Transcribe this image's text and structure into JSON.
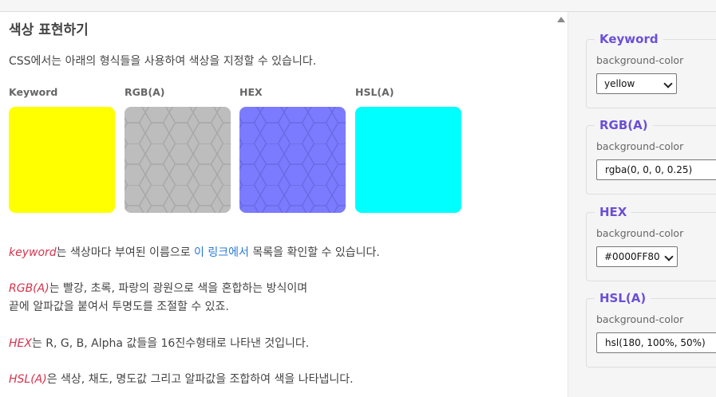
{
  "main": {
    "title": "색상 표현하기",
    "intro": "CSS에서는 아래의 형식들을 사용하여 색상을 지정할 수 있습니다.",
    "swatches": [
      {
        "label": "Keyword",
        "color": "#ffff00"
      },
      {
        "label": "RGB(A)",
        "color": "#bdbdbd"
      },
      {
        "label": "HEX",
        "color": "#7b7bff"
      },
      {
        "label": "HSL(A)",
        "color": "#00ffff"
      }
    ],
    "para_keyword": {
      "term": "keyword",
      "text1": "는 색상마다 부여된 이름으로 ",
      "link": "이 링크에서",
      "text2": " 목록을 확인할 수 있습니다."
    },
    "para_rgb": {
      "term": "RGB(A)",
      "line1": "는 빨강, 초록, 파랑의 광원으로 색을 혼합하는 방식이며",
      "line2": "끝에 알파값을 붙여서 투명도를 조절할 수 있죠."
    },
    "para_hex": {
      "term": "HEX",
      "text": "는 R, G, B, Alpha 값들을 16진수형태로 나타낸 것입니다."
    },
    "para_hsl": {
      "term": "HSL(A)",
      "text": "은 색상, 채도, 명도값 그리고 알파값을 조합하여 색을 나타냅니다."
    }
  },
  "sidebar": {
    "cards": [
      {
        "title": "Keyword",
        "label": "background-color",
        "control": "select",
        "value": "yellow"
      },
      {
        "title": "RGB(A)",
        "label": "background-color",
        "control": "input",
        "value": "rgba(0, 0, 0, 0.25)"
      },
      {
        "title": "HEX",
        "label": "background-color",
        "control": "select",
        "value": "#0000FF80"
      },
      {
        "title": "HSL(A)",
        "label": "background-color",
        "control": "input",
        "value": "hsl(180, 100%, 50%)"
      }
    ]
  },
  "colors": {
    "accent": "#6b4fd6",
    "term": "#d6334d",
    "link": "#2a7ad6"
  }
}
